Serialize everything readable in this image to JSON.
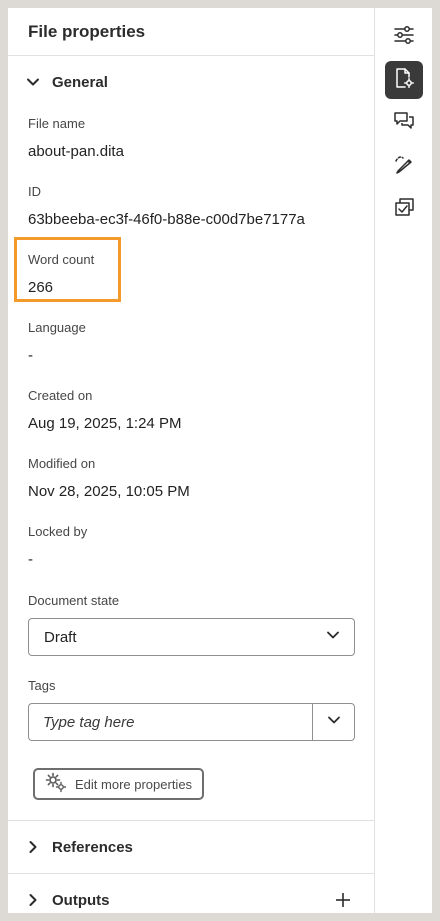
{
  "panel": {
    "title": "File properties"
  },
  "general": {
    "section_label": "General",
    "fields": {
      "file_name": {
        "label": "File name",
        "value": "about-pan.dita"
      },
      "id": {
        "label": "ID",
        "value": "63bbeeba-ec3f-46f0-b88e-c00d7be7177a"
      },
      "word_count": {
        "label": "Word count",
        "value": "266"
      },
      "language": {
        "label": "Language",
        "value": "-"
      },
      "created_on": {
        "label": "Created on",
        "value": "Aug 19, 2025, 1:24 PM"
      },
      "modified_on": {
        "label": "Modified on",
        "value": "Nov 28, 2025, 10:05 PM"
      },
      "locked_by": {
        "label": "Locked by",
        "value": "-"
      }
    },
    "document_state": {
      "label": "Document state",
      "selected": "Draft"
    },
    "tags": {
      "label": "Tags",
      "placeholder": "Type tag here"
    },
    "edit_more_label": "Edit more properties"
  },
  "sections": {
    "references": "References",
    "outputs": "Outputs"
  },
  "rail": {
    "items": [
      "settings-sliders-icon",
      "file-properties-icon",
      "comments-icon",
      "review-pen-icon",
      "versions-check-icon"
    ],
    "active": "file-properties-icon"
  },
  "colors": {
    "highlight": "#f39a2b",
    "active_rail": "#3a3a3a"
  }
}
